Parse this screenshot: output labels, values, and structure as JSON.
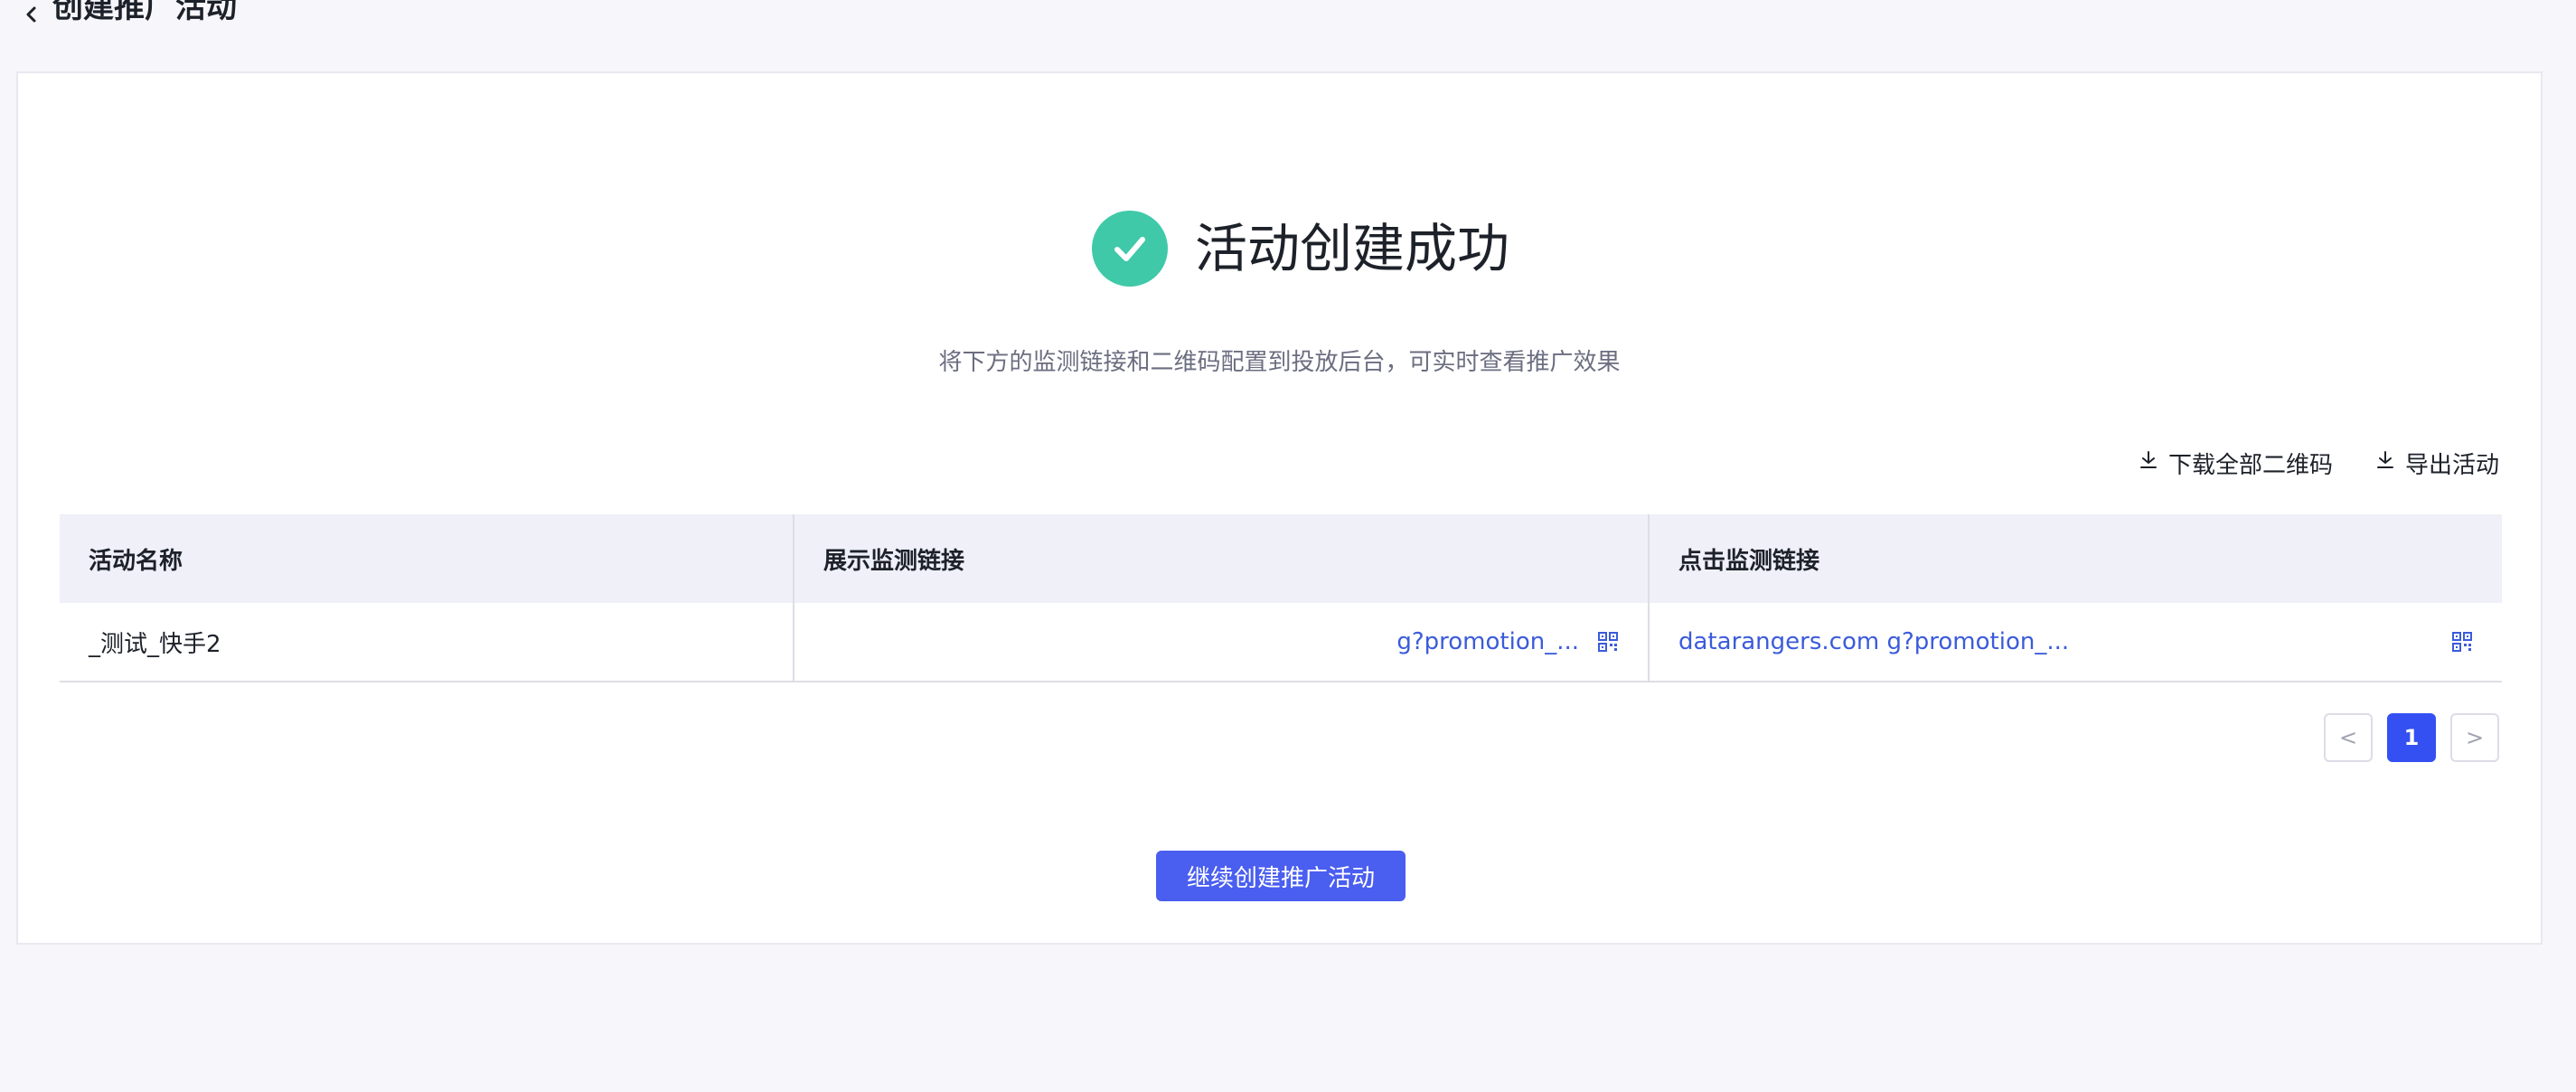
{
  "header": {
    "title": "创建推广活动"
  },
  "result": {
    "title": "活动创建成功",
    "subtitle": "将下方的监测链接和二维码配置到投放后台，可实时查看推广效果"
  },
  "actions": {
    "download_all_qr": "下载全部二维码",
    "export_activity": "导出活动"
  },
  "table": {
    "columns": [
      "活动名称",
      "展示监测链接",
      "点击监测链接"
    ],
    "rows": [
      {
        "name": "_测试_快手2",
        "impression_link": "g?promotion_...",
        "click_link": "datarangers.com g?promotion_..."
      }
    ]
  },
  "pagination": {
    "prev": "<",
    "current": "1",
    "next": ">"
  },
  "footer": {
    "continue_label": "继续创建推广活动"
  },
  "colors": {
    "success": "#3fc9a8",
    "primary": "#3450f2",
    "link": "#3b5bdb"
  }
}
